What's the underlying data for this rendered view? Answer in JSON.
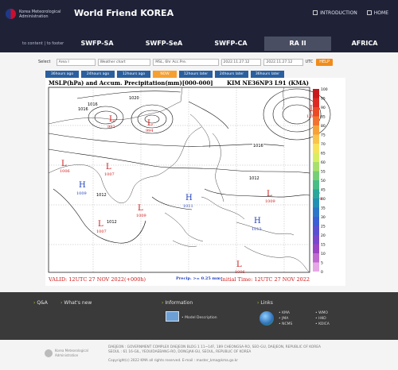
{
  "header": {
    "org_line1": "Korea Meteorological",
    "org_line2": "Administration",
    "site_title": "World Friend KOREA",
    "introduction": "INTRODUCTION",
    "home": "HOME",
    "skip_content": "to content",
    "skip_footer": "to footer"
  },
  "nav": [
    "SWFP-SA",
    "SWFP-SeA",
    "SWFP-CA",
    "RA II",
    "AFRICA"
  ],
  "controls": {
    "select_label": "Select",
    "area": "Area I",
    "chart": "Weather chart",
    "product": "MSL, 6hr Acc.Pre.",
    "date_from": "2022.11.27.12",
    "date_to": "2022.11.27.12",
    "tz": "UTC",
    "help": "HELP"
  },
  "time_buttons": [
    "36hours ago",
    "24hours ago",
    "12hours ago",
    "NOW",
    "12hours later",
    "24hours later",
    "36hours later"
  ],
  "chart": {
    "title_left": "MSLP(hPa) and Accum. Precipitation(mm)[000-000]",
    "title_right": "KIM NE36NP3 L91 (KMA)",
    "valid": "VALID: 12UTC 27 NOV 2022(+000h)",
    "precip": "Precip. >= 0.25 mm",
    "initial": "Initial Time: 12UTC 27 NOV 2022",
    "scale": [
      "100",
      "95",
      "90",
      "85",
      "80",
      "75",
      "70",
      "65",
      "60",
      "55",
      "50",
      "45",
      "40",
      "35",
      "30",
      "25",
      "20",
      "15",
      "10",
      "5",
      "0"
    ],
    "scale_colors": [
      "#c81a1a",
      "#dd2a22",
      "#ea4a26",
      "#f27330",
      "#f7a13b",
      "#f9c34c",
      "#f8e25a",
      "#d7ee63",
      "#a9e06c",
      "#76cf77",
      "#48bd86",
      "#2aa79a",
      "#2290b5",
      "#2a77c9",
      "#3a5fd4",
      "#5a4fd2",
      "#7a47cb",
      "#9b45c4",
      "#c06ad0",
      "#e6a7e6"
    ],
    "highs": [
      {
        "label": "H",
        "value": "1009"
      },
      {
        "label": "H",
        "value": "1011"
      },
      {
        "label": "H",
        "value": "1013"
      }
    ],
    "lows": [
      {
        "label": "L",
        "value": "992"
      },
      {
        "label": "L",
        "value": "994"
      },
      {
        "label": "L",
        "value": "1081"
      },
      {
        "label": "L",
        "value": "1006"
      },
      {
        "label": "L",
        "value": "1007"
      },
      {
        "label": "L",
        "value": "1009"
      },
      {
        "label": "L",
        "value": "1009"
      },
      {
        "label": "L",
        "value": "1007"
      },
      {
        "label": "L",
        "value": "1009"
      },
      {
        "label": "L",
        "value": "1006"
      }
    ],
    "isobars": [
      "1016",
      "1012",
      "1016",
      "1020",
      "1016",
      "1012",
      "1012"
    ]
  },
  "footer": {
    "qna": "Q&A",
    "whats_new": "What's new",
    "information": "Information",
    "model_description": "Model Description",
    "links": "Links",
    "link_items": [
      "KMA",
      "WMO",
      "JMA",
      "HKO",
      "NCMS",
      "KOICA"
    ],
    "address1": "DAEJEON : GOVERNMENT COMPLEX DAEJEON BLDG 1 11~14F, 189 CHEONGSA-RO, SEO-GU, DAEJEON, REPUBLIC OF KOREA",
    "address2": "SEOUL : 61 16-GIL, YEOUIDAEBANG-RO, DONGJAK-GU, SEOUL, REPUBLIC OF KOREA",
    "copyright": "Copyright(c) 2022 KMA all rights reserved. E-mail : master_kma@kma.go.kr"
  }
}
